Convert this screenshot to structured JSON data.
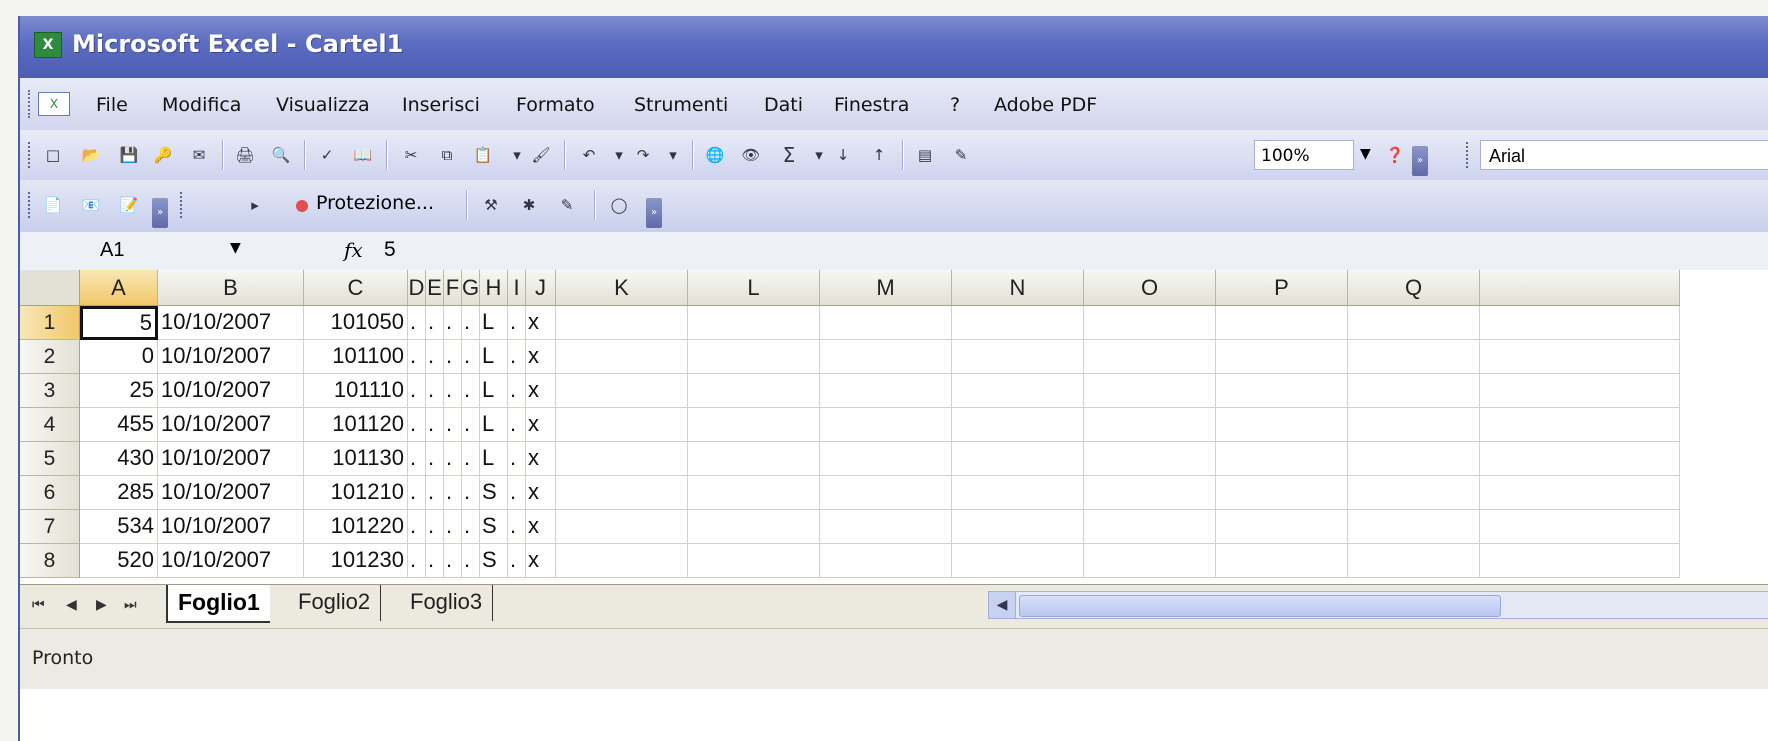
{
  "window": {
    "title": "Microsoft Excel - Cartel1",
    "app_icon": "excel-icon"
  },
  "menu": {
    "doc_icon": "excel-document-icon",
    "items": [
      "File",
      "Modifica",
      "Visualizza",
      "Inserisci",
      "Formato",
      "Strumenti",
      "Dati",
      "Finestra",
      "?",
      "Adobe PDF"
    ]
  },
  "toolbar": {
    "zoom": "100%",
    "font": "Arial",
    "sum_symbol": "Σ",
    "protect_label": "Protezione..."
  },
  "formula_bar": {
    "cell_ref": "A1",
    "fx_label": "fx",
    "formula": "5"
  },
  "sheet": {
    "columns": [
      "A",
      "B",
      "C",
      "D",
      "E",
      "F",
      "G",
      "H",
      "I",
      "J",
      "K",
      "L",
      "M",
      "N",
      "O",
      "P",
      "Q"
    ],
    "rows": [
      {
        "n": "1",
        "a": "5",
        "b": "10/10/2007",
        "c": "101050",
        "d": ".",
        "e": ".",
        "f": ".",
        "g": ".",
        "h": "L",
        "i": ".",
        "j": "x"
      },
      {
        "n": "2",
        "a": "0",
        "b": "10/10/2007",
        "c": "101100",
        "d": ".",
        "e": ".",
        "f": ".",
        "g": ".",
        "h": "L",
        "i": ".",
        "j": "x"
      },
      {
        "n": "3",
        "a": "25",
        "b": "10/10/2007",
        "c": "101110",
        "d": ".",
        "e": ".",
        "f": ".",
        "g": ".",
        "h": "L",
        "i": ".",
        "j": "x"
      },
      {
        "n": "4",
        "a": "455",
        "b": "10/10/2007",
        "c": "101120",
        "d": ".",
        "e": ".",
        "f": ".",
        "g": ".",
        "h": "L",
        "i": ".",
        "j": "x"
      },
      {
        "n": "5",
        "a": "430",
        "b": "10/10/2007",
        "c": "101130",
        "d": ".",
        "e": ".",
        "f": ".",
        "g": ".",
        "h": "L",
        "i": ".",
        "j": "x"
      },
      {
        "n": "6",
        "a": "285",
        "b": "10/10/2007",
        "c": "101210",
        "d": ".",
        "e": ".",
        "f": ".",
        "g": ".",
        "h": "S",
        "i": ".",
        "j": "x"
      },
      {
        "n": "7",
        "a": "534",
        "b": "10/10/2007",
        "c": "101220",
        "d": ".",
        "e": ".",
        "f": ".",
        "g": ".",
        "h": "S",
        "i": ".",
        "j": "x"
      },
      {
        "n": "8",
        "a": "520",
        "b": "10/10/2007",
        "c": "101230",
        "d": ".",
        "e": ".",
        "f": ".",
        "g": ".",
        "h": "S",
        "i": ".",
        "j": "x"
      }
    ]
  },
  "tabs": {
    "sheets": [
      "Foglio1",
      "Foglio2",
      "Foglio3"
    ],
    "active": "Foglio1"
  },
  "status": {
    "text": "Pronto"
  }
}
